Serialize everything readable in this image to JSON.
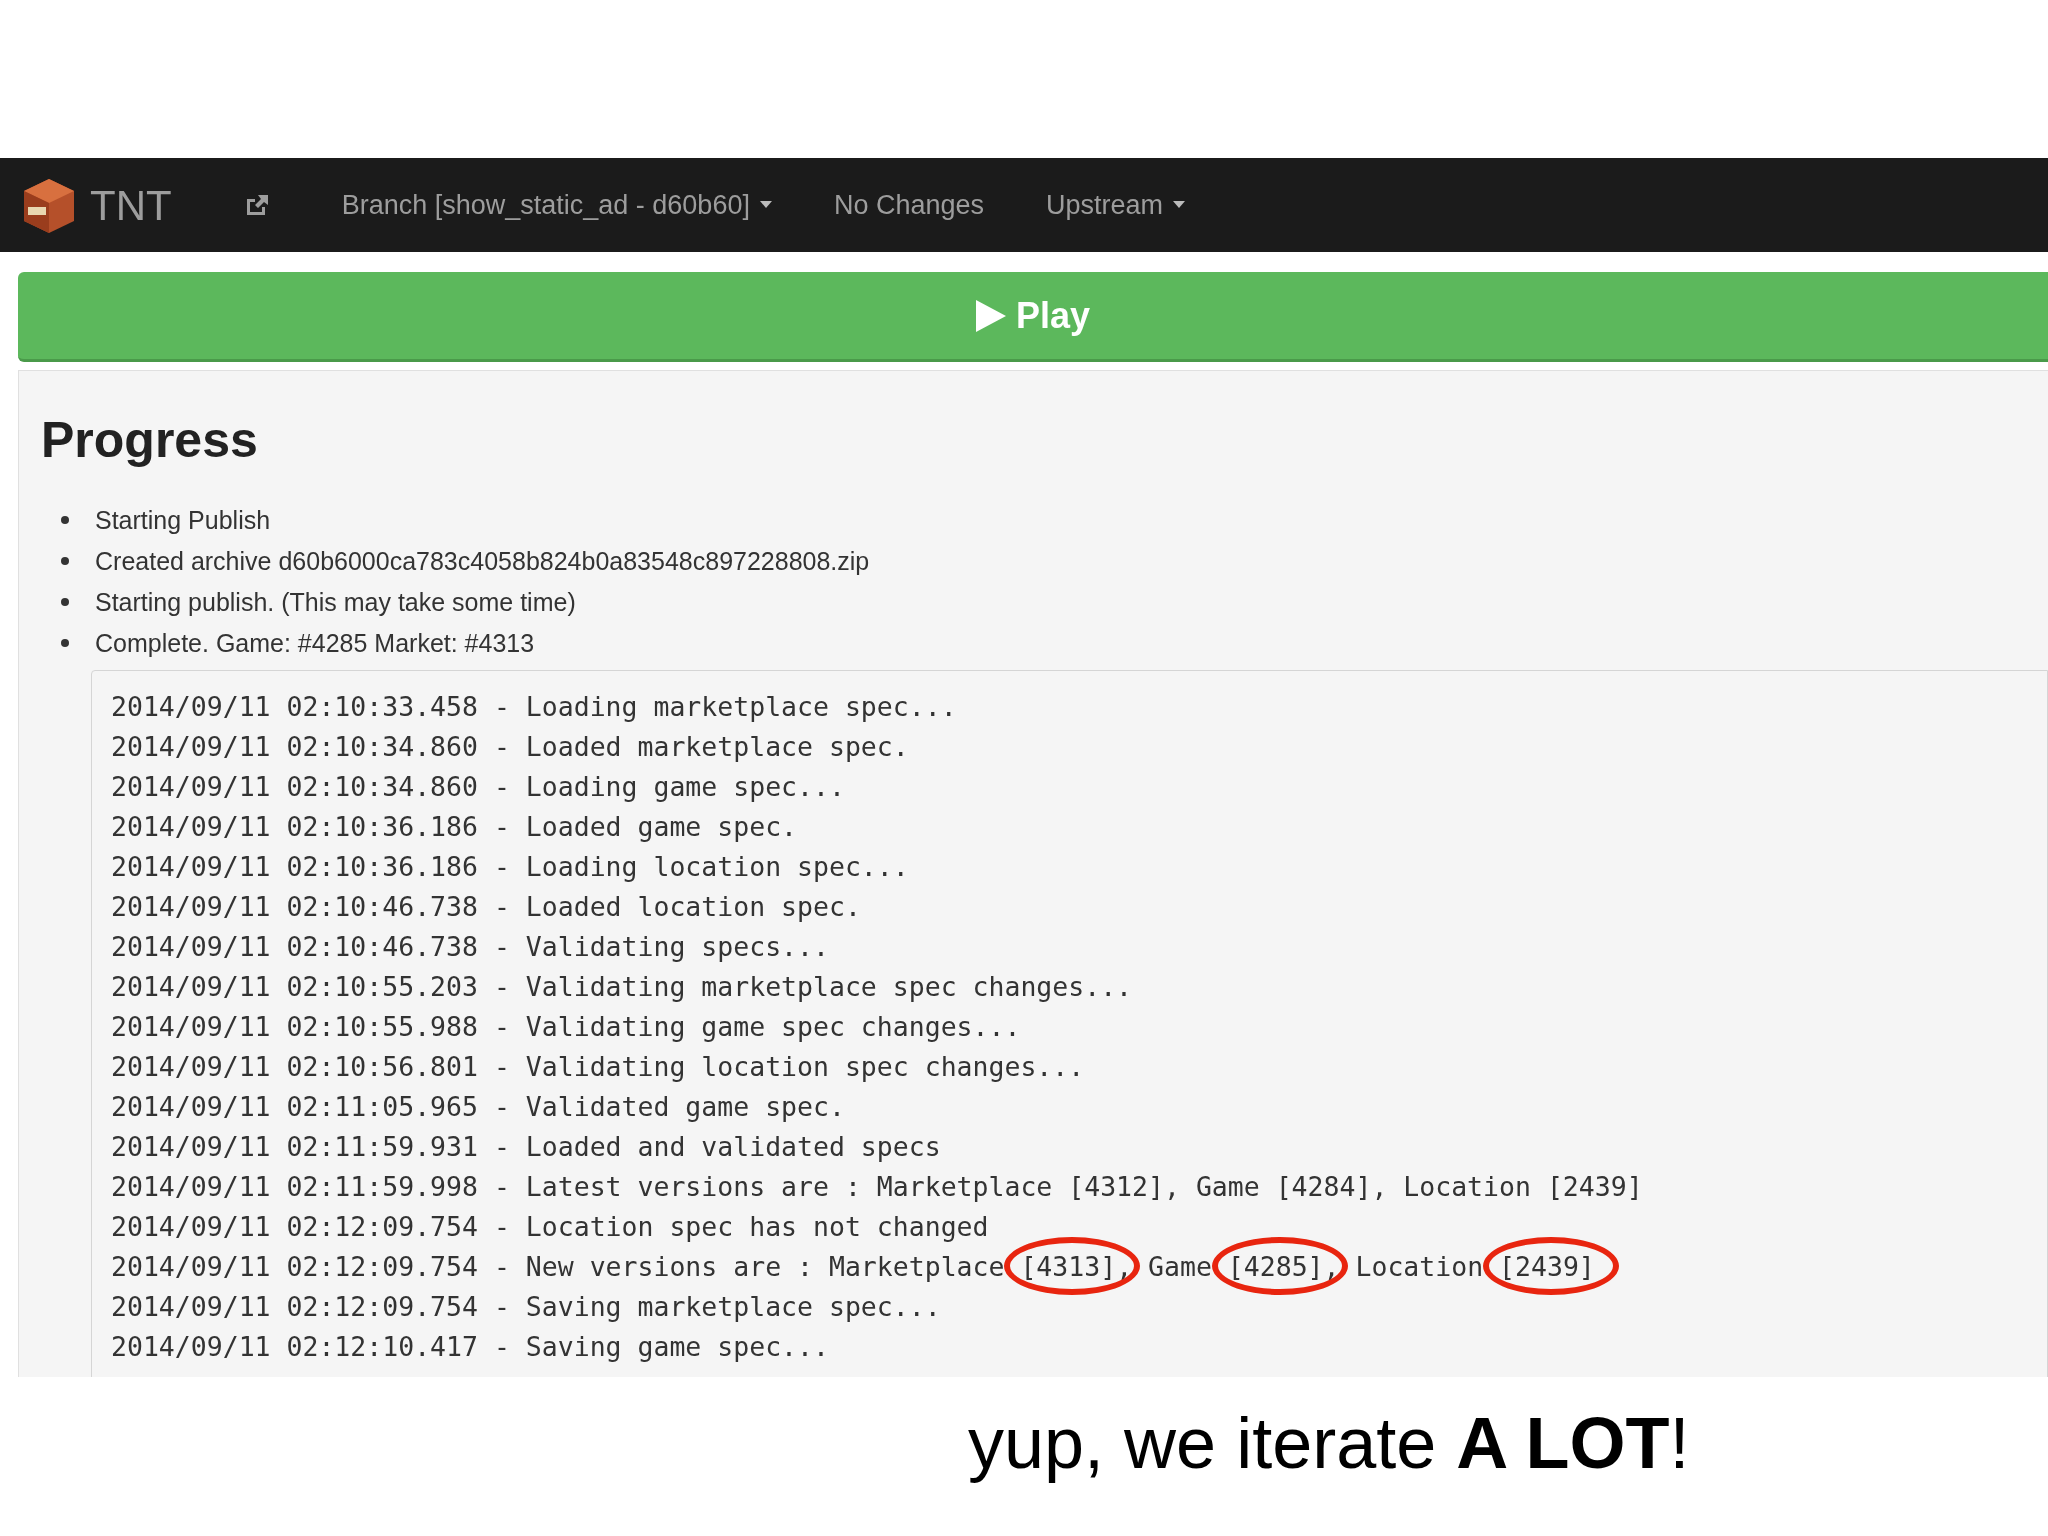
{
  "navbar": {
    "brand": "TNT",
    "items": [
      {
        "label": "Branch [show_static_ad - d60b60]",
        "dropdown": true
      },
      {
        "label": "No Changes",
        "dropdown": false
      },
      {
        "label": "Upstream",
        "dropdown": true
      }
    ]
  },
  "play_button": {
    "label": "Play"
  },
  "progress": {
    "title": "Progress",
    "steps": [
      "Starting Publish",
      "Created archive d60b6000ca783c4058b824b0a83548c897228808.zip",
      "Starting publish. (This may take some time)",
      "Complete. Game: #4285 Market: #4313"
    ],
    "log": [
      {
        "text": "2014/09/11 02:10:33.458 - Loading marketplace spec..."
      },
      {
        "text": "2014/09/11 02:10:34.860 - Loaded marketplace spec."
      },
      {
        "text": "2014/09/11 02:10:34.860 - Loading game spec..."
      },
      {
        "text": "2014/09/11 02:10:36.186 - Loaded game spec."
      },
      {
        "text": "2014/09/11 02:10:36.186 - Loading location spec..."
      },
      {
        "text": "2014/09/11 02:10:46.738 - Loaded location spec."
      },
      {
        "text": "2014/09/11 02:10:46.738 - Validating specs..."
      },
      {
        "text": "2014/09/11 02:10:55.203 - Validating marketplace spec changes..."
      },
      {
        "text": "2014/09/11 02:10:55.988 - Validating game spec changes..."
      },
      {
        "text": "2014/09/11 02:10:56.801 - Validating location spec changes..."
      },
      {
        "text": "2014/09/11 02:11:05.965 - Validated game spec."
      },
      {
        "text": "2014/09/11 02:11:59.931 - Loaded and validated specs"
      },
      {
        "text": "2014/09/11 02:11:59.998 - Latest versions are : Marketplace [4312], Game [4284], Location [2439]"
      },
      {
        "text": "2014/09/11 02:12:09.754 - Location spec has not changed"
      },
      {
        "segments": [
          {
            "text": "2014/09/11 02:12:09.754 - New versions are : Marketplace ",
            "circled": false
          },
          {
            "text": "[4313]",
            "circled": true
          },
          {
            "text": ", Game ",
            "circled": false
          },
          {
            "text": "[4285]",
            "circled": true
          },
          {
            "text": ", Location ",
            "circled": false
          },
          {
            "text": "[2439]",
            "circled": true
          }
        ]
      },
      {
        "text": "2014/09/11 02:12:09.754 - Saving marketplace spec..."
      },
      {
        "text": "2014/09/11 02:12:10.417 - Saving game spec..."
      }
    ]
  },
  "caption": "yup, we iterate **A LOT**!"
}
